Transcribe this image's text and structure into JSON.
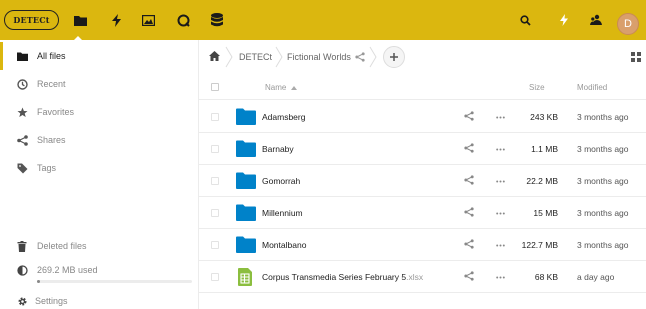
{
  "header": {
    "logo_text": "DETECt",
    "accent_color": "#dbb70f",
    "apps": [
      {
        "name": "files",
        "icon": "folder-icon"
      },
      {
        "name": "activity",
        "icon": "lightning-icon"
      },
      {
        "name": "gallery",
        "icon": "image-icon"
      },
      {
        "name": "talk",
        "icon": "search-circle-icon"
      },
      {
        "name": "database",
        "icon": "database-icon"
      }
    ],
    "right_icons": [
      "search-icon",
      "notifications-icon",
      "contacts-icon"
    ],
    "avatar_initial": "D"
  },
  "sidebar": {
    "items": [
      {
        "label": "All files",
        "icon": "folder-icon",
        "active": true
      },
      {
        "label": "Recent",
        "icon": "clock-icon"
      },
      {
        "label": "Favorites",
        "icon": "star-icon"
      },
      {
        "label": "Shares",
        "icon": "share-icon"
      },
      {
        "label": "Tags",
        "icon": "tag-icon"
      }
    ],
    "deleted_label": "Deleted files",
    "quota_label": "269.2 MB used",
    "quota_fraction": 0.02,
    "settings_label": "Settings"
  },
  "breadcrumb": {
    "items": [
      "DETECt",
      "Fictional Worlds"
    ]
  },
  "table": {
    "columns": {
      "name": "Name",
      "size": "Size",
      "modified": "Modified"
    },
    "rows": [
      {
        "name": "Adamsberg",
        "ext": "",
        "type": "folder",
        "size": "243 KB",
        "modified": "3 months ago"
      },
      {
        "name": "Barnaby",
        "ext": "",
        "type": "folder",
        "size": "1.1 MB",
        "modified": "3 months ago"
      },
      {
        "name": "Gomorrah",
        "ext": "",
        "type": "folder",
        "size": "22.2 MB",
        "modified": "3 months ago"
      },
      {
        "name": "Millennium",
        "ext": "",
        "type": "folder",
        "size": "15 MB",
        "modified": "3 months ago"
      },
      {
        "name": "Montalbano",
        "ext": "",
        "type": "folder",
        "size": "122.7 MB",
        "modified": "3 months ago"
      },
      {
        "name": "Corpus Transmedia Series February 5",
        "ext": ".xlsx",
        "type": "spreadsheet",
        "size": "68 KB",
        "modified": "a day ago"
      }
    ]
  }
}
